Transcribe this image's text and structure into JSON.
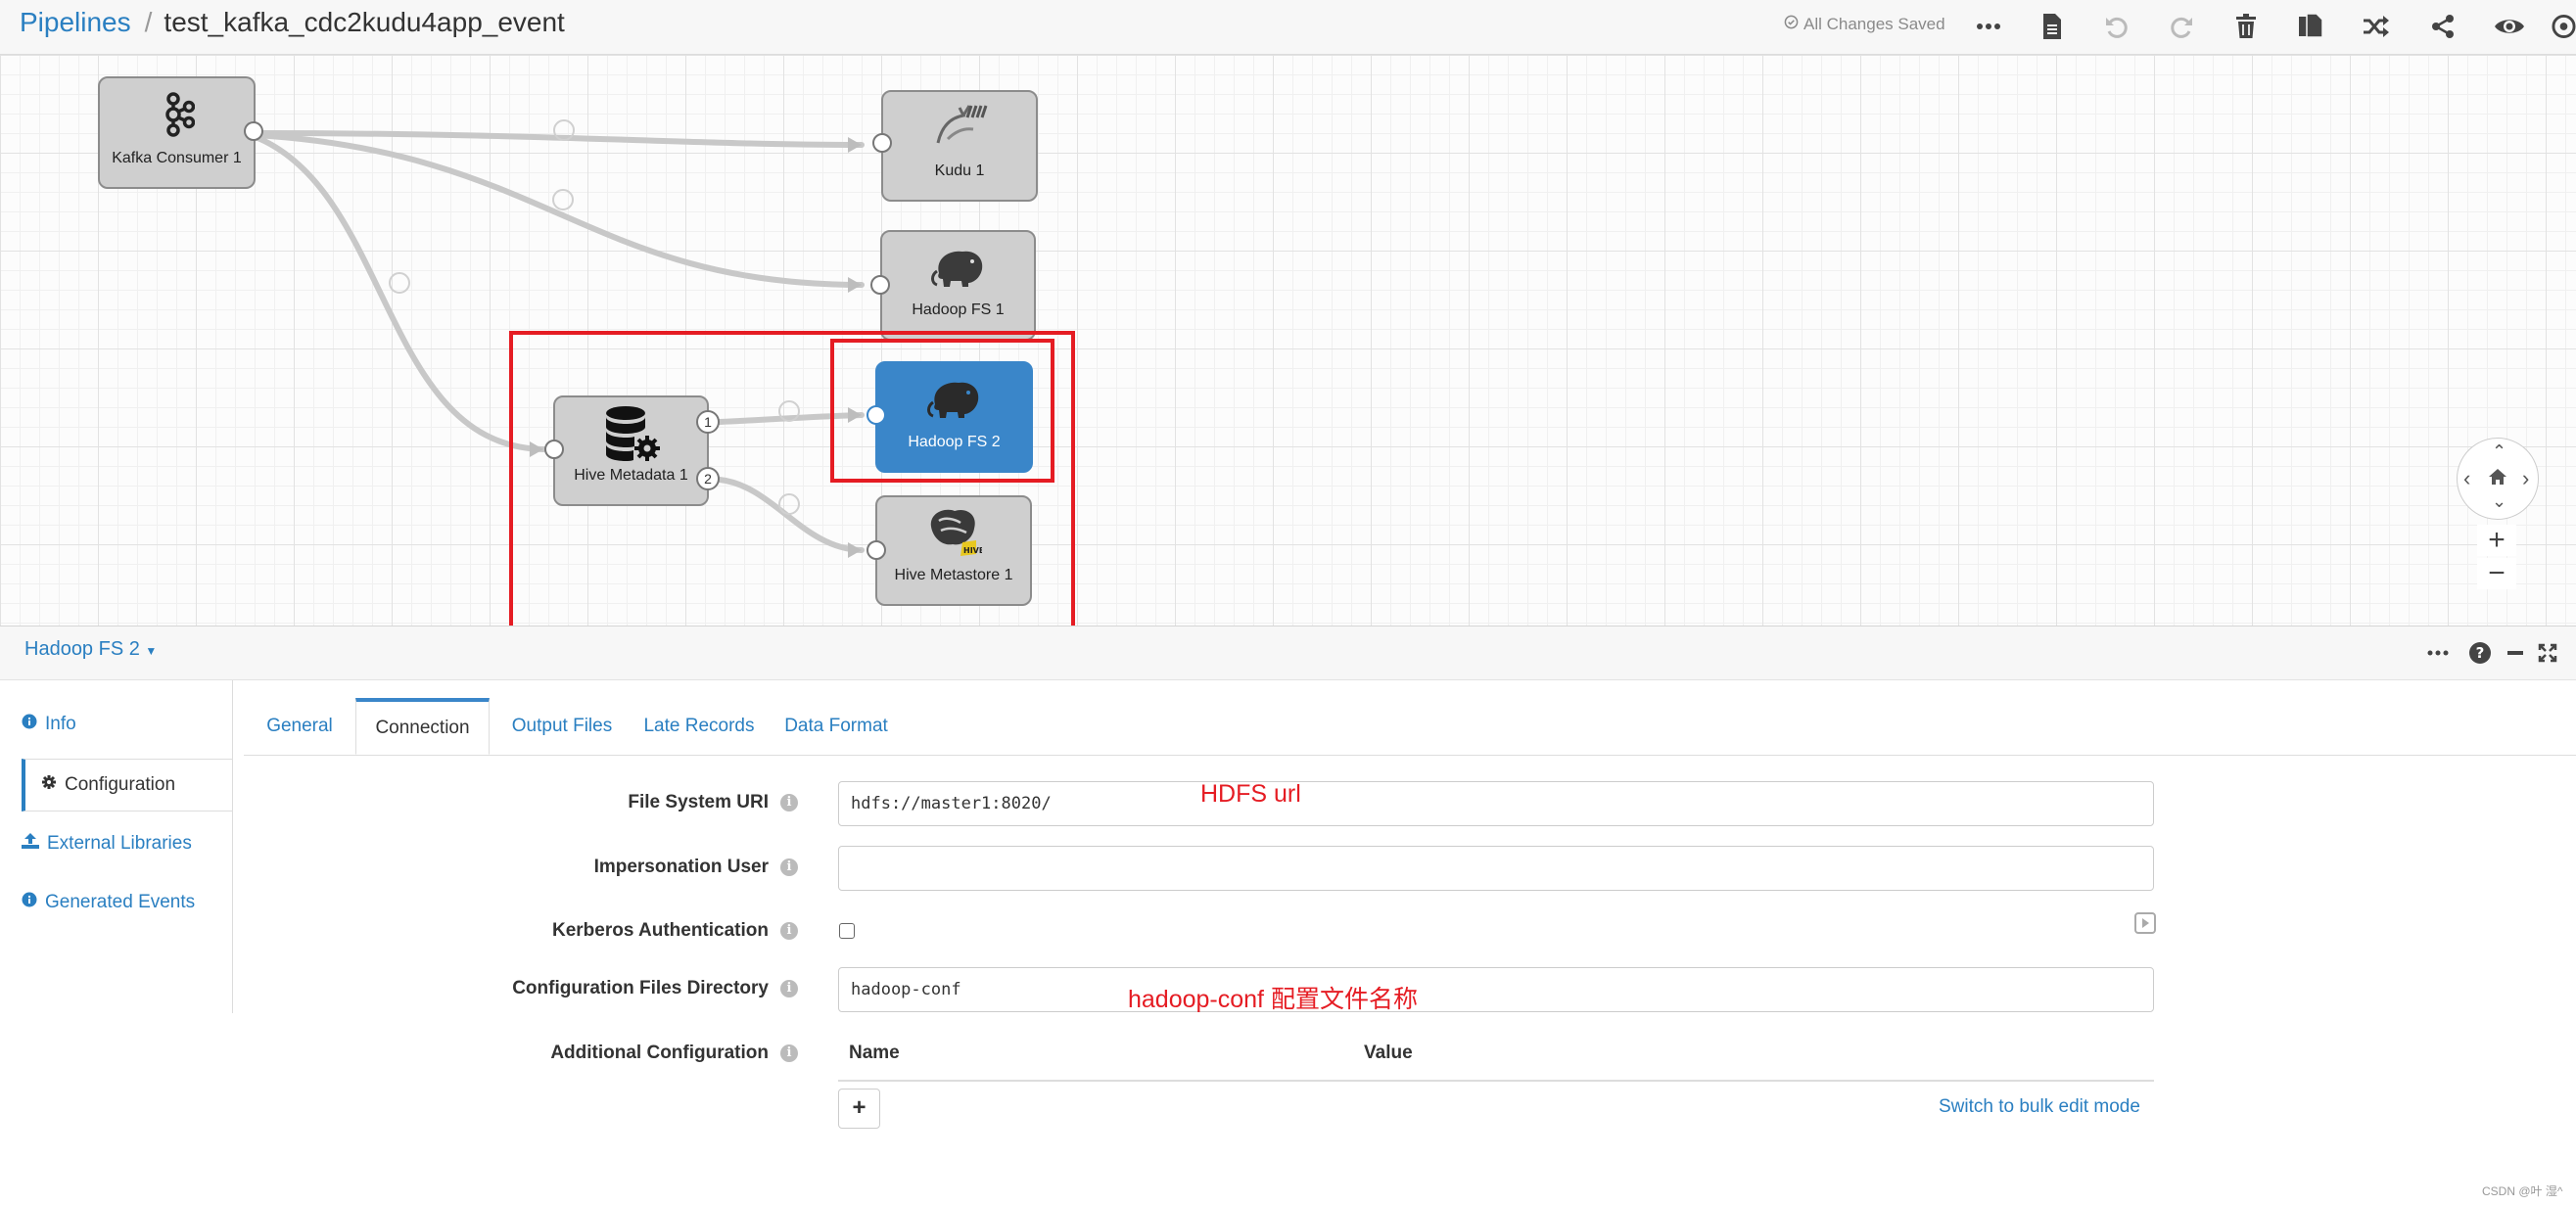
{
  "header": {
    "breadcrumb_root": "Pipelines",
    "breadcrumb_separator": "/",
    "pipeline_name": "test_kafka_cdc2kudu4app_event",
    "save_status": "All Changes Saved",
    "toolbar_icons": [
      "more-icon",
      "document-icon",
      "undo-icon",
      "redo-icon",
      "delete-icon",
      "copy-icon",
      "shuffle-icon",
      "share-icon",
      "preview-icon",
      "settings-icon"
    ]
  },
  "canvas": {
    "nodes": [
      {
        "id": "kafka",
        "label": "Kafka Consumer 1",
        "icon": "kafka-icon"
      },
      {
        "id": "kudu",
        "label": "Kudu 1",
        "icon": "kudu-icon"
      },
      {
        "id": "hdfs1",
        "label": "Hadoop FS 1",
        "icon": "hadoop-elephant-icon"
      },
      {
        "id": "hive_meta",
        "label": "Hive Metadata 1",
        "icon": "database-gear-icon",
        "outputs": [
          "1",
          "2"
        ]
      },
      {
        "id": "hdfs2",
        "label": "Hadoop FS 2",
        "icon": "hadoop-elephant-icon",
        "selected": true
      },
      {
        "id": "hive_store",
        "label": "Hive Metastore 1",
        "icon": "hive-icon"
      }
    ],
    "highlight_color": "#e51c23",
    "selected_color": "#3a86c9"
  },
  "panel": {
    "stage_title": "Hadoop FS 2",
    "side_nav": [
      {
        "label": "Info",
        "icon": "info-icon"
      },
      {
        "label": "Configuration",
        "icon": "gear-icon",
        "active": true
      },
      {
        "label": "External Libraries",
        "icon": "upload-icon"
      },
      {
        "label": "Generated Events",
        "icon": "info-icon"
      }
    ],
    "tabs": [
      "General",
      "Connection",
      "Output Files",
      "Late Records",
      "Data Format"
    ],
    "active_tab": "Connection",
    "fields": {
      "fs_uri": {
        "label": "File System URI",
        "value": "hdfs://master1:8020/"
      },
      "impersonation": {
        "label": "Impersonation User",
        "value": ""
      },
      "kerberos": {
        "label": "Kerberos Authentication",
        "checked": false
      },
      "conf_dir": {
        "label": "Configuration Files Directory",
        "value": "hadoop-conf"
      },
      "additional": {
        "label": "Additional Configuration",
        "col_name": "Name",
        "col_value": "Value",
        "add_label": "+",
        "bulk_label": "Switch to bulk edit mode"
      }
    },
    "annotations": {
      "hdfs_url": "HDFS url",
      "conf_name": "hadoop-conf  配置文件名称"
    }
  },
  "watermark": "CSDN @叶 湿^"
}
